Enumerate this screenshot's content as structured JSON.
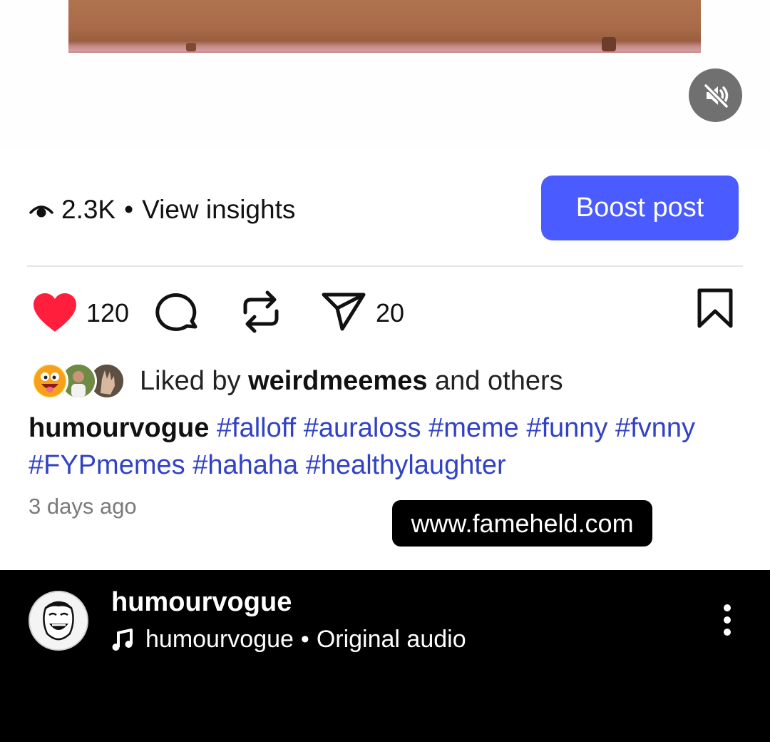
{
  "media": {
    "mute_icon": "speaker-muted-icon",
    "colors": {
      "strip": "#a86a48",
      "mute_bg": "#707070"
    }
  },
  "insights": {
    "eye_icon": "eye-icon",
    "views": "2.3K",
    "separator": "•",
    "view_insights_label": "View insights"
  },
  "boost": {
    "label": "Boost post",
    "color": "#4a5cff"
  },
  "actions": {
    "like_icon": "heart-icon",
    "like_count": "120",
    "comment_icon": "comment-icon",
    "repost_icon": "repost-icon",
    "share_icon": "send-icon",
    "share_count": "20",
    "save_icon": "bookmark-icon",
    "like_color": "#ff1f3d"
  },
  "liked_by": {
    "prefix": "Liked by",
    "user": "weirdmeemes",
    "suffix": "and others"
  },
  "caption": {
    "username": "humourvogue",
    "hashtags": [
      "#falloff",
      "#auraloss",
      "#meme",
      "#funny",
      "#fvnny",
      "#FYPmemes",
      "#hahaha",
      "#healthylaughter"
    ],
    "tag_color": "#3142c4"
  },
  "time_ago": "3 days ago",
  "watermark": "www.fameheld.com",
  "bottom_bar": {
    "username": "humourvogue",
    "audio_icon": "music-note-icon",
    "audio_user": "humourvogue",
    "audio_separator": "•",
    "audio_label": "Original audio",
    "more_icon": "more-vertical-icon"
  }
}
